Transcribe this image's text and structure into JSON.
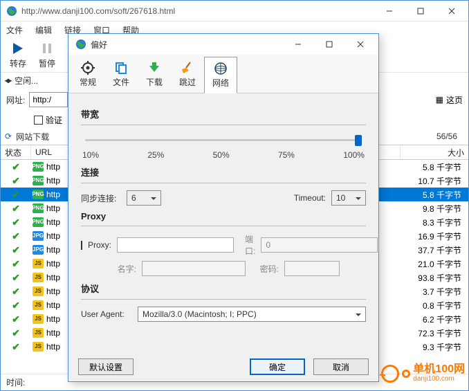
{
  "main": {
    "url": "http://www.danji100.com/soft/267618.html",
    "menus": [
      "文件",
      "编辑",
      "链接",
      "窗口",
      "帮助"
    ],
    "toolbar": {
      "save": "转存",
      "pause": "暂停"
    },
    "status_idle": "空闲...",
    "addr_label": "网址:",
    "addr_value": "http:/",
    "addr_tail": "这页",
    "verify_label": "验证",
    "refresh_label": "网站下载",
    "counter": "56/56",
    "columns": {
      "status": "状态",
      "url": "URL",
      "size": "大小"
    },
    "rows": [
      {
        "type": "png",
        "url": "http",
        "size": "5.8 千字节",
        "selected": false
      },
      {
        "type": "png",
        "url": "http",
        "size": "10.7 千字节",
        "selected": false
      },
      {
        "type": "png",
        "url": "http",
        "size": "5.8 千字节",
        "selected": true
      },
      {
        "type": "png",
        "url": "http",
        "size": "9.8 千字节",
        "selected": false
      },
      {
        "type": "png",
        "url": "http",
        "size": "8.3 千字节",
        "selected": false
      },
      {
        "type": "jpg",
        "url": "http",
        "size": "16.9 千字节",
        "selected": false
      },
      {
        "type": "jpg",
        "url": "http",
        "size": "37.7 千字节",
        "selected": false
      },
      {
        "type": "js",
        "url": "http",
        "size": "21.0 千字节",
        "selected": false
      },
      {
        "type": "js",
        "url": "http",
        "size": "93.8 千字节",
        "selected": false
      },
      {
        "type": "js",
        "url": "http",
        "size": "3.7 千字节",
        "selected": false
      },
      {
        "type": "js",
        "url": "http",
        "size": "0.8 千字节",
        "selected": false
      },
      {
        "type": "js",
        "url": "http",
        "size": "6.2 千字节",
        "selected": false
      },
      {
        "type": "js",
        "url": "http",
        "size": "72.3 千字节",
        "selected": false
      },
      {
        "type": "js",
        "url": "http",
        "size": "9.3 千字节",
        "selected": false
      }
    ],
    "footer_time": "时间:"
  },
  "dialog": {
    "title": "偏好",
    "tabs": [
      "常规",
      "文件",
      "下载",
      "跳过",
      "网络"
    ],
    "active_tab": 4,
    "bandwidth": {
      "title": "带宽",
      "labels": [
        "10%",
        "25%",
        "50%",
        "75%",
        "100%"
      ]
    },
    "connection": {
      "title": "连接",
      "sync_label": "同步连接:",
      "sync_value": "6",
      "timeout_label": "Timeout:",
      "timeout_value": "10"
    },
    "proxy": {
      "title": "Proxy",
      "checkbox_label": "Proxy:",
      "host": "",
      "port_label": "端口:",
      "port_value": "0",
      "name_label": "名字:",
      "name_value": "",
      "pass_label": "密码:",
      "pass_value": ""
    },
    "protocol": {
      "title": "协议",
      "ua_label": "User Agent:",
      "ua_value": "Mozilla/3.0 (Macintosh; I; PPC)"
    },
    "buttons": {
      "defaults": "默认设置",
      "ok": "确定",
      "cancel": "取消"
    }
  },
  "watermark": {
    "brand": "单机100网",
    "domain": "danji100.com"
  }
}
